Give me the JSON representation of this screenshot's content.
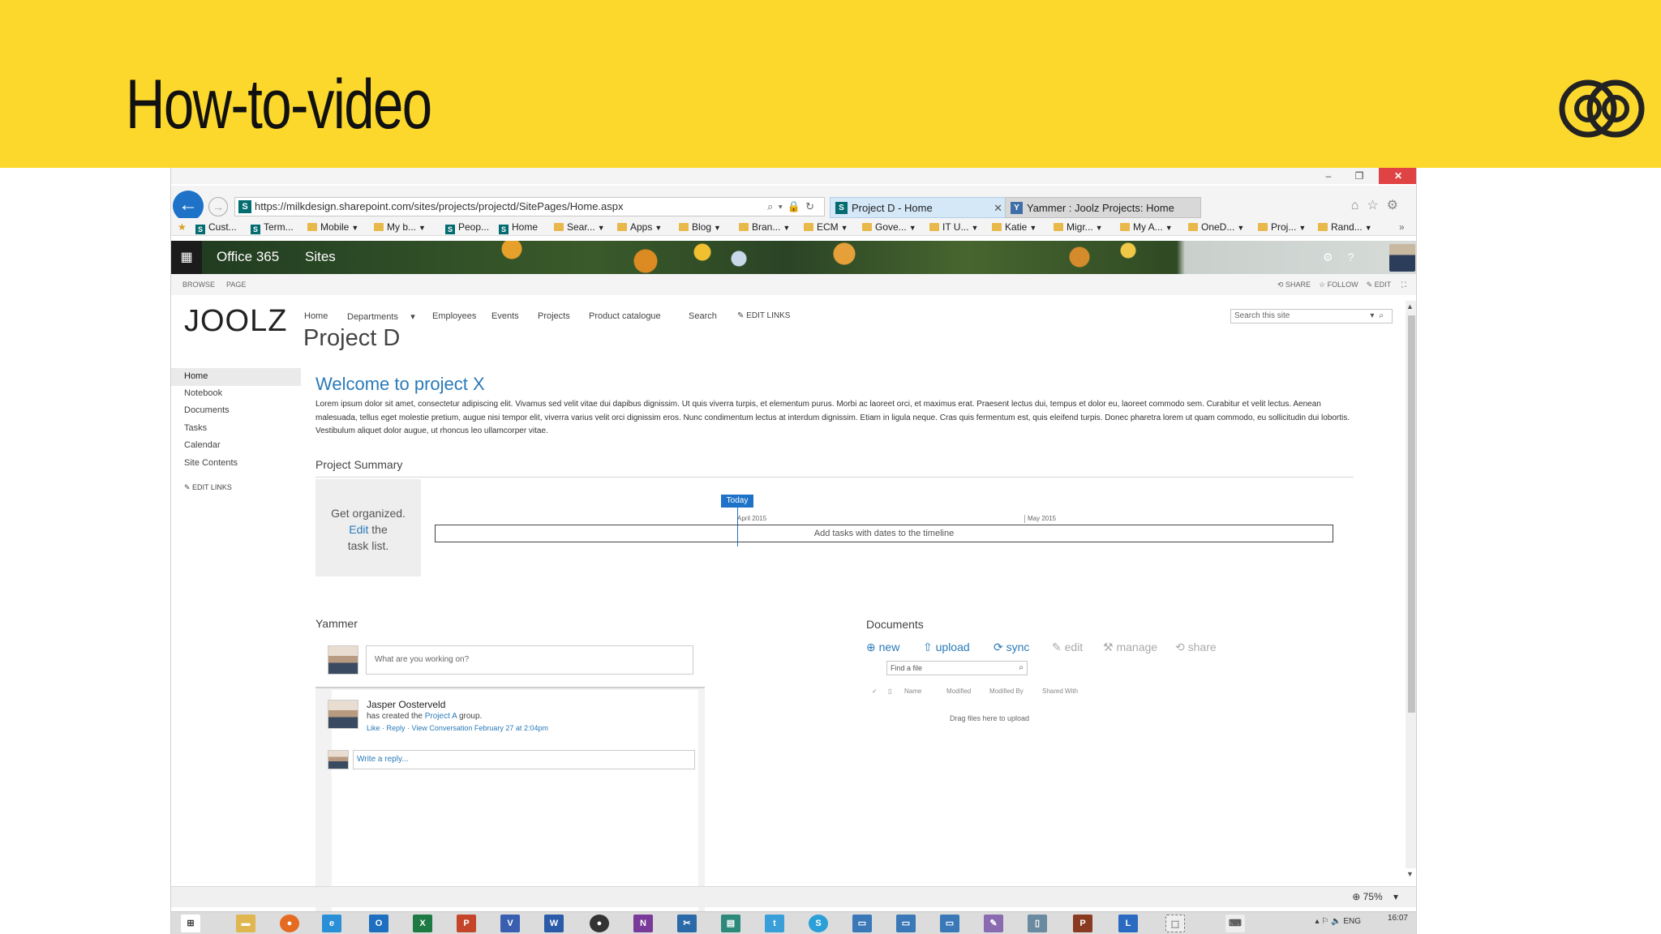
{
  "slide": {
    "title": "How-to-video",
    "colors": {
      "band": "#fcd82d",
      "accent": "#2a7ab8"
    }
  },
  "browser": {
    "url": "https://milkdesign.sharepoint.com/sites/projects/projectd/SitePages/Home.aspx",
    "tabs": [
      {
        "label": "Project D - Home",
        "active": true
      },
      {
        "label": "Yammer : Joolz Projects: Home",
        "active": false
      }
    ],
    "window_buttons": [
      "–",
      "❐",
      "✕"
    ],
    "favorites": [
      {
        "label": "Cust...",
        "icon": "sharepoint-icon",
        "dropdown": false
      },
      {
        "label": "Term...",
        "icon": "sharepoint-icon",
        "dropdown": false
      },
      {
        "label": "Mobile",
        "icon": "folder-icon",
        "dropdown": true
      },
      {
        "label": "My b...",
        "icon": "folder-icon",
        "dropdown": true
      },
      {
        "label": "Peop...",
        "icon": "sharepoint-icon",
        "dropdown": false
      },
      {
        "label": "Home",
        "icon": "sharepoint-icon",
        "dropdown": false
      },
      {
        "label": "Sear...",
        "icon": "folder-icon",
        "dropdown": true
      },
      {
        "label": "Apps",
        "icon": "folder-icon",
        "dropdown": true
      },
      {
        "label": "Blog",
        "icon": "folder-icon",
        "dropdown": true
      },
      {
        "label": "Bran...",
        "icon": "folder-icon",
        "dropdown": true
      },
      {
        "label": "ECM",
        "icon": "folder-icon",
        "dropdown": true
      },
      {
        "label": "Gove...",
        "icon": "folder-icon",
        "dropdown": true
      },
      {
        "label": "IT U...",
        "icon": "folder-icon",
        "dropdown": true
      },
      {
        "label": "Katie",
        "icon": "folder-icon",
        "dropdown": true
      },
      {
        "label": "Migr...",
        "icon": "folder-icon",
        "dropdown": true
      },
      {
        "label": "My A...",
        "icon": "folder-icon",
        "dropdown": true
      },
      {
        "label": "OneD...",
        "icon": "folder-icon",
        "dropdown": true
      },
      {
        "label": "Proj...",
        "icon": "folder-icon",
        "dropdown": true
      },
      {
        "label": "Rand...",
        "icon": "folder-icon",
        "dropdown": true
      }
    ],
    "zoom": "75%"
  },
  "suitebar": {
    "brand": "Office 365",
    "app": "Sites"
  },
  "ribbon": {
    "browse": "BROWSE",
    "page": "PAGE",
    "share": "SHARE",
    "follow": "FOLLOW",
    "edit": "EDIT"
  },
  "site": {
    "logo": "JOOLZ",
    "title": "Project D",
    "topnav": [
      "Home",
      "Departments",
      "Employees",
      "Events",
      "Projects",
      "Product catalogue",
      "Search"
    ],
    "topnav_edit": "EDIT LINKS",
    "search_placeholder": "Search this site",
    "leftnav": [
      "Home",
      "Notebook",
      "Documents",
      "Tasks",
      "Calendar",
      "Site Contents"
    ],
    "leftnav_edit": "EDIT LINKS"
  },
  "main": {
    "welcome": "Welcome to project X",
    "lorem": "Lorem ipsum dolor sit amet, consectetur adipiscing elit. Vivamus sed velit vitae dui dapibus dignissim. Ut quis viverra turpis, et elementum purus. Morbi ac laoreet orci, et maximus erat. Praesent lectus dui, tempus et dolor eu, laoreet commodo sem. Curabitur et velit lectus. Aenean malesuada, tellus eget molestie pretium, augue nisi tempor elit, viverra varius velit orci dignissim eros. Nunc condimentum lectus at interdum dignissim. Etiam in ligula neque. Cras quis fermentum est, quis eleifend turpis. Donec pharetra lorem ut quam commodo, eu sollicitudin dui lobortis. Vestibulum aliquet dolor augue, ut rhoncus leo ullamcorper vitae.",
    "summary": {
      "heading": "Project Summary",
      "box_line1": "Get organized.",
      "box_edit": "Edit",
      "box_line2_rest": "the",
      "box_line3": "task list.",
      "today": "Today",
      "month_1": "April 2015",
      "month_2": "May 2015",
      "timeline_text": "Add tasks with dates to the timeline"
    }
  },
  "yammer": {
    "heading": "Yammer",
    "input_placeholder": "What are you working on?",
    "post": {
      "author": "Jasper Oosterveld",
      "text_prefix": "has created the",
      "group": "Project A",
      "text_suffix": "group.",
      "actions": "Like · Reply · View Conversation",
      "timestamp": "February 27 at 2:04pm"
    },
    "reply_placeholder": "Write a reply..."
  },
  "documents": {
    "heading": "Documents",
    "actions": [
      {
        "icon": "plus-circle-icon",
        "label": "new",
        "enabled": true
      },
      {
        "icon": "upload-icon",
        "label": "upload",
        "enabled": true
      },
      {
        "icon": "sync-icon",
        "label": "sync",
        "enabled": true
      },
      {
        "icon": "pencil-icon",
        "label": "edit",
        "enabled": false
      },
      {
        "icon": "wrench-icon",
        "label": "manage",
        "enabled": false
      },
      {
        "icon": "share-icon",
        "label": "share",
        "enabled": false
      }
    ],
    "find_placeholder": "Find a file",
    "columns": [
      "Name",
      "Modified",
      "Modified By",
      "Shared With"
    ],
    "drag_note": "Drag files here to upload"
  },
  "taskbar": {
    "apps": [
      "start",
      "explorer",
      "firefox",
      "ie",
      "outlook",
      "excel",
      "powerpoint",
      "visio",
      "word",
      "keepass",
      "onenote",
      "snipping",
      "publisher",
      "twitter",
      "skype",
      "remote-desktop-1",
      "remote-desktop-2",
      "remote-desktop-3",
      "paint",
      "notepad",
      "project",
      "lync"
    ],
    "language": "ENG",
    "time": "16:07"
  }
}
